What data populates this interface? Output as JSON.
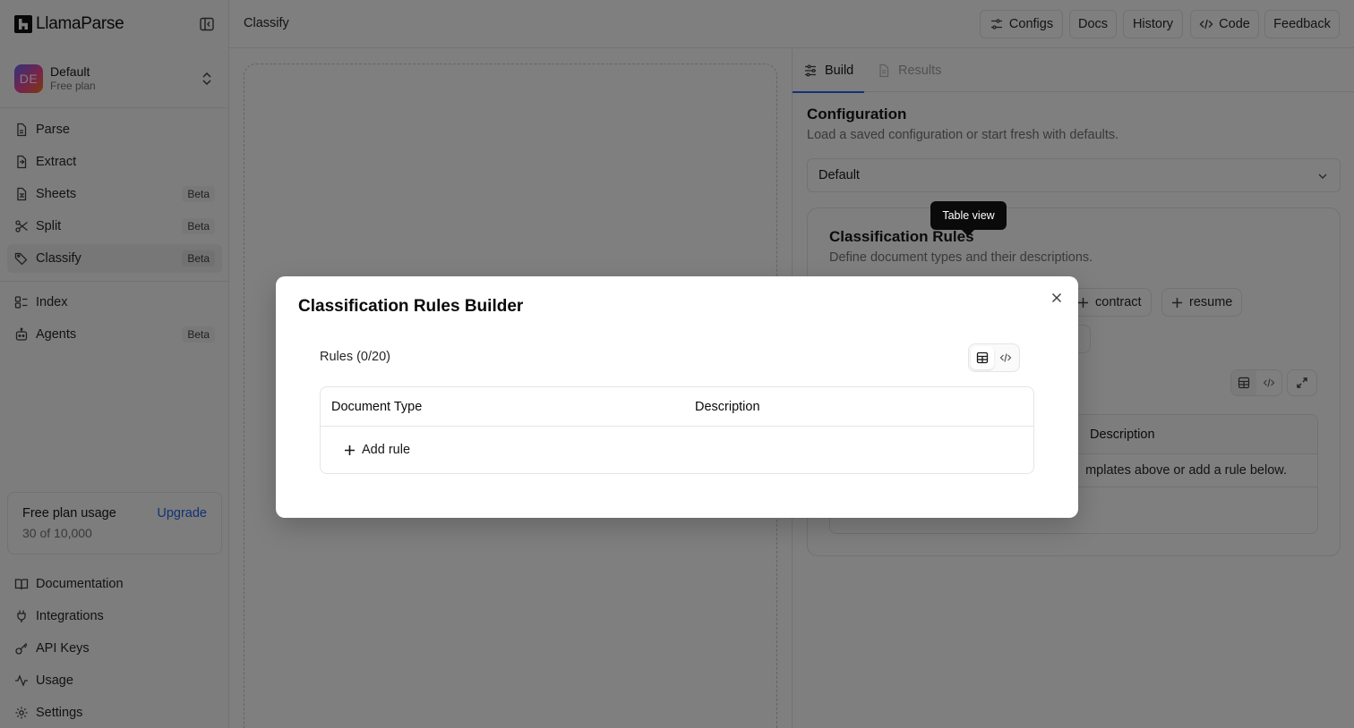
{
  "app": {
    "name": "LlamaParse"
  },
  "org": {
    "initials": "DE",
    "name": "Default",
    "plan": "Free plan"
  },
  "nav_primary": [
    {
      "label": "Parse",
      "icon": "parse-icon",
      "badge": ""
    },
    {
      "label": "Extract",
      "icon": "extract-icon",
      "badge": ""
    },
    {
      "label": "Sheets",
      "icon": "sheets-icon",
      "badge": "Beta"
    },
    {
      "label": "Split",
      "icon": "scissors-icon",
      "badge": "Beta"
    },
    {
      "label": "Classify",
      "icon": "tag-icon",
      "badge": "Beta",
      "active": true
    }
  ],
  "nav_secondary": [
    {
      "label": "Index",
      "icon": "index-icon",
      "badge": ""
    },
    {
      "label": "Agents",
      "icon": "bot-icon",
      "badge": "Beta"
    }
  ],
  "usage": {
    "title": "Free plan usage",
    "count": "30 of 10,000",
    "upgrade": "Upgrade"
  },
  "nav_footer": [
    {
      "label": "Documentation",
      "icon": "book-icon"
    },
    {
      "label": "Integrations",
      "icon": "plug-icon"
    },
    {
      "label": "API Keys",
      "icon": "key-icon"
    },
    {
      "label": "Usage",
      "icon": "activity-icon"
    },
    {
      "label": "Settings",
      "icon": "gear-icon"
    }
  ],
  "topbar": {
    "breadcrumb": "Classify",
    "configs": "Configs",
    "docs": "Docs",
    "history": "History",
    "code": "Code",
    "feedback": "Feedback"
  },
  "panel": {
    "tabs": {
      "build": "Build",
      "results": "Results"
    },
    "config_title": "Configuration",
    "config_sub": "Load a saved configuration or start fresh with defaults.",
    "config_value": "Default",
    "rules_title": "Classification Rules",
    "rules_sub": "Define document types and their descriptions.",
    "chips": [
      "contract",
      "resume"
    ],
    "table_description_header": "Description",
    "empty_text": "mplates above or add a rule below."
  },
  "tooltip": "Table view",
  "modal": {
    "title": "Classification Rules Builder",
    "rules_count": "Rules (0/20)",
    "col_document_type": "Document Type",
    "col_description": "Description",
    "add_rule": "Add rule"
  },
  "colors": {
    "accent": "#2563eb",
    "overlay": "rgba(0,0,0,0.5)"
  }
}
